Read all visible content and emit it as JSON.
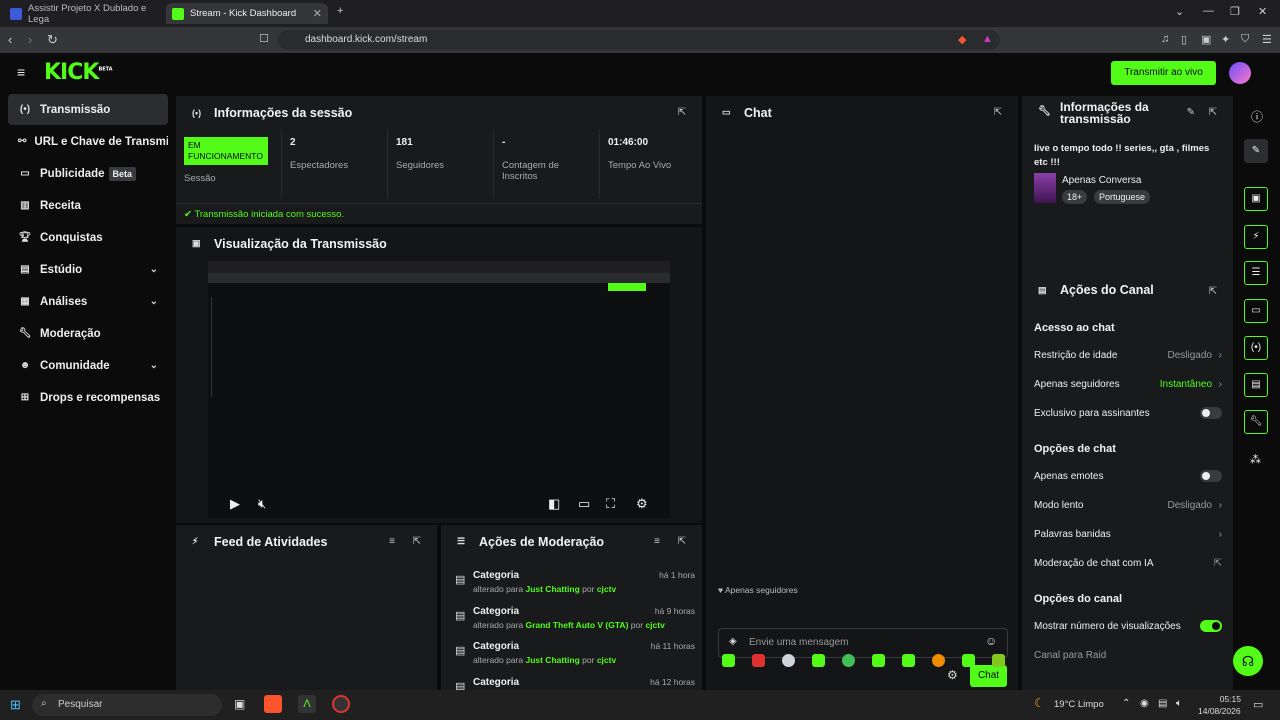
{
  "browser": {
    "tabs": [
      {
        "title": "Assistir Projeto X Dublado e Lega"
      },
      {
        "title": "Stream - Kick Dashboard"
      }
    ],
    "url": "dashboard.kick.com/stream"
  },
  "header": {
    "logo": "KICK",
    "logo_badge": "BETA",
    "go_live_label": "Transmitir ao vivo"
  },
  "sidebar": {
    "items": [
      {
        "label": "Transmissão",
        "icon": "broadcast-icon"
      },
      {
        "label": "URL e Chave de Transmissão",
        "icon": "link-icon"
      },
      {
        "label": "Publicidade",
        "badge": "Beta",
        "icon": "ad-icon"
      },
      {
        "label": "Receita",
        "icon": "revenue-icon"
      },
      {
        "label": "Conquistas",
        "icon": "trophy-icon"
      },
      {
        "label": "Estúdio",
        "icon": "studio-icon"
      },
      {
        "label": "Análises",
        "icon": "chart-icon"
      },
      {
        "label": "Moderação",
        "icon": "wrench-icon"
      },
      {
        "label": "Comunidade",
        "icon": "community-icon"
      },
      {
        "label": "Drops e recompensas",
        "icon": "drops-icon"
      }
    ]
  },
  "session": {
    "title": "Informações da sessão",
    "status_badge": "EM FUNCIONAMENTO",
    "status_label": "Sessão",
    "stats": [
      {
        "value": "2",
        "label": "Espectadores"
      },
      {
        "value": "181",
        "label": "Seguidores"
      },
      {
        "value": "-",
        "label": "Contagem de Inscritos"
      },
      {
        "value": "01:46:00",
        "label": "Tempo Ao Vivo"
      }
    ],
    "success_msg": "Transmissão iniciada com sucesso."
  },
  "preview": {
    "title": "Visualização da Transmissão"
  },
  "activity": {
    "title": "Feed de Atividades"
  },
  "moderation": {
    "title": "Ações de Moderação",
    "rows": [
      {
        "cat": "Categoria",
        "pre": "alterado para",
        "game": "Just Chatting",
        "by": "por",
        "user": "cjctv",
        "time": "há 1 hora"
      },
      {
        "cat": "Categoria",
        "pre": "alterado para",
        "game": "Grand Theft Auto V (GTA)",
        "by": "por",
        "user": "cjctv",
        "time": "há 9 horas"
      },
      {
        "cat": "Categoria",
        "pre": "alterado para",
        "game": "Just Chatting",
        "by": "por",
        "user": "cjctv",
        "time": "há 11 horas"
      },
      {
        "cat": "Categoria",
        "pre": "",
        "game": "",
        "by": "",
        "user": "",
        "time": "há 12 horas"
      }
    ]
  },
  "chat": {
    "title": "Chat",
    "followers_only": "Apenas seguidores",
    "placeholder": "Envie uma mensagem",
    "send_label": "Chat"
  },
  "stream_info": {
    "title": "Informações da transmissão",
    "stream_title": "live o tempo todo !! series,, gta , filmes etc !!!",
    "category": "Apenas Conversa",
    "tags": [
      "18+",
      "Portuguese"
    ]
  },
  "channel_actions": {
    "title": "Ações do Canal",
    "sections": [
      {
        "heading": "Acesso ao chat"
      },
      {
        "heading": "Opções de chat"
      },
      {
        "heading": "Opções do canal"
      }
    ],
    "rows": {
      "age": {
        "label": "Restrição de idade",
        "value": "Desligado"
      },
      "followers": {
        "label": "Apenas seguidores",
        "value": "Instantâneo"
      },
      "subs": {
        "label": "Exclusivo para assinantes",
        "on": false
      },
      "emotes": {
        "label": "Apenas emotes",
        "on": false
      },
      "slow": {
        "label": "Modo lento",
        "value": "Desligado"
      },
      "banned": {
        "label": "Palavras banidas"
      },
      "ai": {
        "label": "Moderação de chat com IA"
      },
      "views": {
        "label": "Mostrar número de visualizações",
        "on": true
      },
      "raid": {
        "label": "Canal para Raid"
      }
    }
  },
  "taskbar": {
    "search": "Pesquisar",
    "weather": "19°C  Limpo",
    "time": "05:15",
    "date": "14/08/2026"
  },
  "colors": {
    "accent": "#53fc18",
    "panel": "#191a1c",
    "bg": "#0b0b0c"
  }
}
